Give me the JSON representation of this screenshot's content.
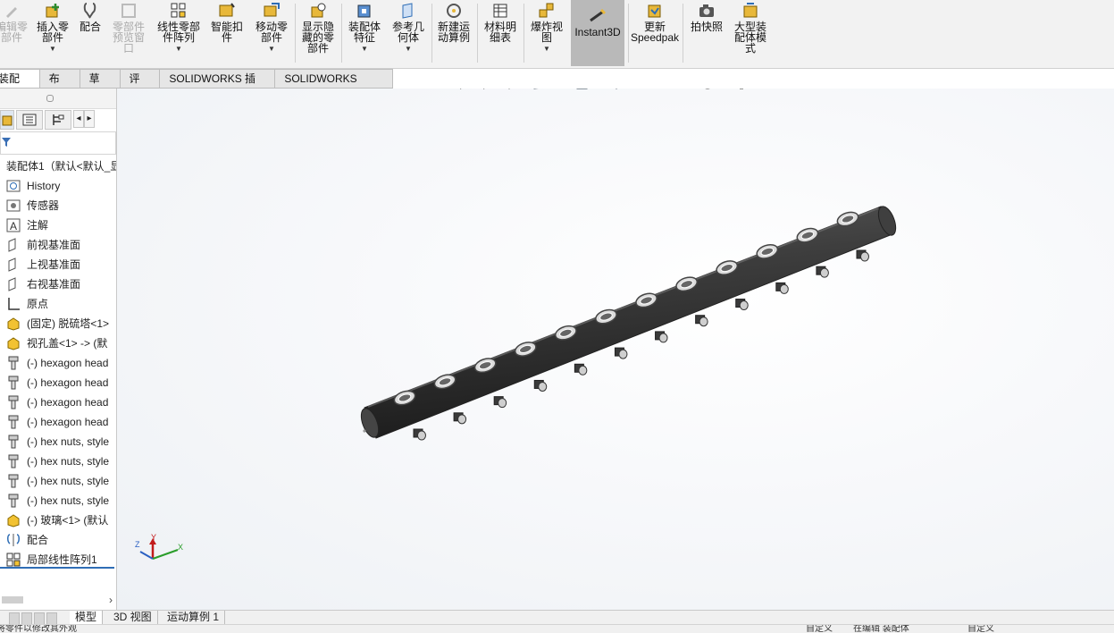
{
  "ribbon": {
    "buttons": [
      {
        "label": "编辑零\n部件",
        "icon": "edit-component-icon",
        "disabled": true
      },
      {
        "label": "插入零\n部件",
        "icon": "insert-component-icon",
        "dropdown": true
      },
      {
        "label": "配合",
        "icon": "mate-icon"
      },
      {
        "label": "零部件\n预览窗\n口",
        "icon": "component-preview-icon",
        "disabled": true
      },
      {
        "label": "线性零部\n件阵列",
        "icon": "linear-pattern-icon",
        "dropdown": true
      },
      {
        "label": "智能扣\n件",
        "icon": "smart-fasteners-icon"
      },
      {
        "label": "移动零\n部件",
        "icon": "move-component-icon",
        "dropdown": true
      },
      {
        "label": "显示隐\n藏的零\n部件",
        "icon": "show-hidden-icon"
      },
      {
        "label": "装配体\n特征",
        "icon": "assembly-feature-icon",
        "dropdown": true
      },
      {
        "label": "参考几\n何体",
        "icon": "reference-geometry-icon",
        "dropdown": true
      },
      {
        "label": "新建运\n动算例",
        "icon": "new-motion-study-icon"
      },
      {
        "label": "材料明\n细表",
        "icon": "bill-of-materials-icon"
      },
      {
        "label": "爆炸视\n图",
        "icon": "exploded-view-icon",
        "dropdown": true
      },
      {
        "label": "Instant3D",
        "icon": "instant3d-icon",
        "active": true
      },
      {
        "label": "更新\nSpeedpak",
        "icon": "update-speedpak-icon"
      },
      {
        "label": "拍快照",
        "icon": "snapshot-icon"
      },
      {
        "label": "大型装\n配体模\n式",
        "icon": "large-assembly-icon"
      }
    ]
  },
  "command_tabs": [
    "装配体",
    "布局",
    "草图",
    "评估",
    "SOLIDWORKS 插件",
    "SOLIDWORKS MBD"
  ],
  "tree": {
    "root": "装配体1（默认<默认_显",
    "items": [
      {
        "label": "History",
        "icon": "history-icon"
      },
      {
        "label": "传感器",
        "icon": "sensor-icon"
      },
      {
        "label": "注解",
        "icon": "annotation-icon"
      },
      {
        "label": "前视基准面",
        "icon": "plane-icon"
      },
      {
        "label": "上视基准面",
        "icon": "plane-icon"
      },
      {
        "label": "右视基准面",
        "icon": "plane-icon"
      },
      {
        "label": "原点",
        "icon": "origin-icon"
      },
      {
        "label": "(固定) 脱硫塔<1>",
        "icon": "part-icon"
      },
      {
        "label": "视孔盖<1> -> (默",
        "icon": "part-icon"
      },
      {
        "label": "(-) hexagon head",
        "icon": "bolt-icon"
      },
      {
        "label": "(-) hexagon head",
        "icon": "bolt-icon"
      },
      {
        "label": "(-) hexagon head",
        "icon": "bolt-icon"
      },
      {
        "label": "(-) hexagon head",
        "icon": "bolt-icon"
      },
      {
        "label": "(-) hex nuts, style",
        "icon": "bolt-icon"
      },
      {
        "label": "(-) hex nuts, style",
        "icon": "bolt-icon"
      },
      {
        "label": "(-) hex nuts, style",
        "icon": "bolt-icon"
      },
      {
        "label": "(-) hex nuts, style",
        "icon": "bolt-icon"
      },
      {
        "label": "(-) 玻璃<1> (默认",
        "icon": "part-icon"
      },
      {
        "label": "配合",
        "icon": "mate-icon"
      },
      {
        "label": "局部线性阵列1",
        "icon": "linear-pattern-icon"
      }
    ]
  },
  "bottom_tabs": [
    "模型",
    "3D 视图",
    "运动算例 1"
  ],
  "status": {
    "left": "将零件以修改其外观",
    "mid": "自定义",
    "mid2": "在编辑 装配体",
    "right": "自定义"
  },
  "triad": {
    "x": "X",
    "y": "Y",
    "z": "Z"
  },
  "colors": {
    "ribbon_bg": "#f2f2f2",
    "active_button": "#b9b9b9",
    "model": "#3a3a3a",
    "selection_blue": "#2f6db5"
  }
}
